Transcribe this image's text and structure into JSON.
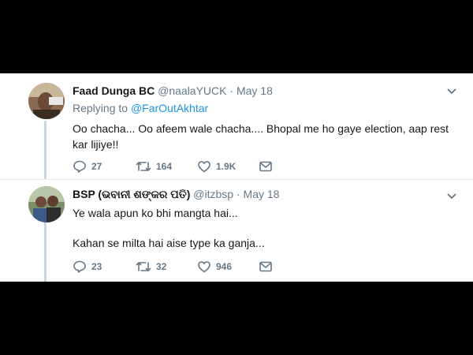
{
  "tweets": [
    {
      "display_name": "Faad Dunga BC",
      "handle": "@naalaYUCK",
      "separator": "·",
      "date": "May 18",
      "replying_label": "Replying to",
      "replying_handle": "@FarOutAkhtar",
      "text": "Oo chacha... Oo afeem wale chacha.... Bhopal me ho gaye election, aap rest kar lijiye!!",
      "replies": "27",
      "retweets": "164",
      "likes": "1.9K",
      "icons": [
        "reply-icon",
        "retweet-icon",
        "like-icon",
        "direct-message-icon",
        "chevron-down-icon"
      ]
    },
    {
      "display_name": "BSP (ଭବାନୀ ଶଙ୍କର ପତି)",
      "handle": "@itzbsp",
      "separator": "·",
      "date": "May 18",
      "text_line1": "Ye wala apun ko bhi mangta hai...",
      "text_line2": "Kahan se milta hai aise type ka ganja...",
      "replies": "23",
      "retweets": "32",
      "likes": "946",
      "icons": [
        "reply-icon",
        "retweet-icon",
        "like-icon",
        "direct-message-icon",
        "chevron-down-icon"
      ]
    }
  ],
  "colors": {
    "background": "#000000",
    "card": "#ffffff",
    "link": "#1b95e0",
    "muted": "#657786",
    "thread_line": "#c4d9e4"
  }
}
